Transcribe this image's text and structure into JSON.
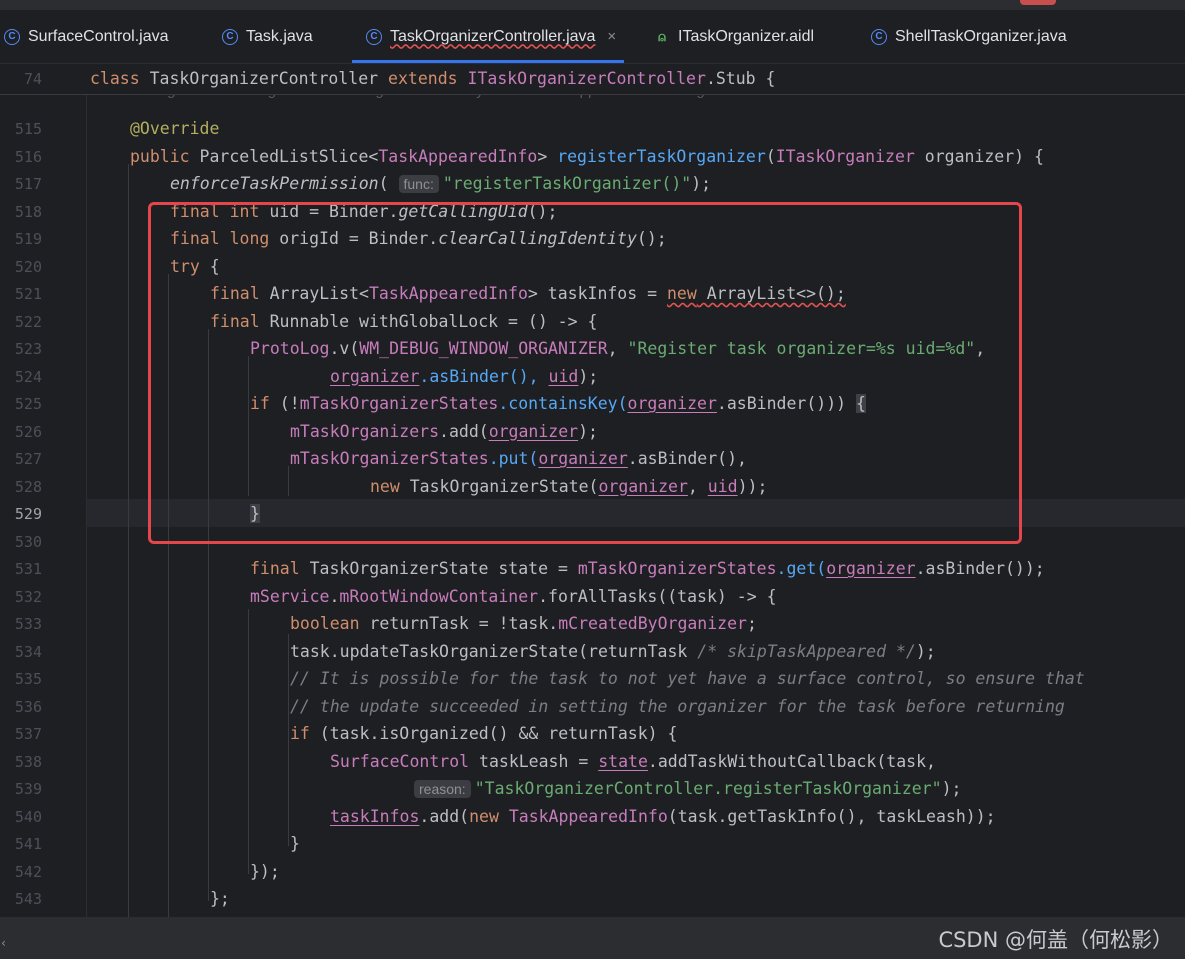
{
  "tabs": [
    {
      "label": "SurfaceControl.java",
      "icon": "java-class-icon"
    },
    {
      "label": "Task.java",
      "icon": "java-class-icon"
    },
    {
      "label": "TaskOrganizerController.java",
      "icon": "java-class-icon",
      "active": true
    },
    {
      "label": "ITaskOrganizer.aidl",
      "icon": "android-aidl-icon"
    },
    {
      "label": "ShellTaskOrganizer.java",
      "icon": "java-class-icon"
    }
  ],
  "tab_close_glyph": "×",
  "sticky": {
    "line_number": "74",
    "code": "class TaskOrganizerController extends ITaskOrganizerController.Stub {"
  },
  "ghost_comment": "Register a TaskOrganizer to manage tasks as they enter the a supported windowing mode.",
  "inlay_hints": {
    "func": "func:",
    "reason": "reason:"
  },
  "current_line": "529",
  "line_numbers": [
    "515",
    "516",
    "517",
    "518",
    "519",
    "520",
    "521",
    "522",
    "523",
    "524",
    "525",
    "526",
    "527",
    "528",
    "529",
    "530",
    "531",
    "532",
    "533",
    "534",
    "535",
    "536",
    "537",
    "538",
    "539",
    "540",
    "541",
    "542",
    "543"
  ],
  "code": {
    "l515": {
      "annot": "@Override"
    },
    "l516": {
      "kw": "public",
      "ret": "ParceledListSlice<",
      "type": "TaskAppearedInfo",
      "close": "> ",
      "method": "registerTaskOrganizer",
      "open": "(",
      "ptype": "ITaskOrganizer",
      "rest": " organizer) {"
    },
    "l517": {
      "call": "enforceTaskPermission",
      "open": "(",
      "str": "\"registerTaskOrganizer()\"",
      "end": ");"
    },
    "l518": {
      "kw": "final int",
      "a": " uid = Binder.",
      "m": "getCallingUid",
      "b": "();"
    },
    "l519": {
      "kw": "final long",
      "a": " origId = Binder.",
      "m": "clearCallingIdentity",
      "b": "();"
    },
    "l520": {
      "kw": "try",
      "a": " {"
    },
    "l521": {
      "kw": "final",
      "a": " ArrayList<",
      "type": "TaskAppearedInfo",
      "b": "> taskInfos = ",
      "kw2": "new",
      "c": " ArrayList<>();"
    },
    "l522": {
      "kw": "final",
      "a": " Runnable withGlobalLock = () -> {"
    },
    "l523": {
      "cls": "ProtoLog",
      "a": ".v(",
      "const": "WM_DEBUG_WINDOW_ORGANIZER",
      "b": ", ",
      "str": "\"Register task organizer=%s uid=%d\"",
      "c": ","
    },
    "l524": {
      "p1": "organizer",
      "a": ".asBinder(), ",
      "p2": "uid",
      "b": ");"
    },
    "l525": {
      "kw": "if",
      "a": " (!",
      "fld": "mTaskOrganizerStates",
      "m": ".containsKey(",
      "p": "organizer",
      "b": ".asBinder())) ",
      "brace": "{"
    },
    "l526": {
      "fld": "mTaskOrganizers",
      "a": ".add(",
      "p": "organizer",
      "b": ");"
    },
    "l527": {
      "fld": "mTaskOrganizerStates",
      "m": ".put(",
      "p": "organizer",
      "b": ".asBinder(),"
    },
    "l528": {
      "kw": "new",
      "a": " TaskOrganizerState(",
      "p1": "organizer",
      "b": ", ",
      "p2": "uid",
      "c": "));"
    },
    "l529": {
      "brace": "}"
    },
    "l531": {
      "kw": "final",
      "a": " TaskOrganizerState state = ",
      "fld": "mTaskOrganizerStates",
      "m": ".get(",
      "p": "organizer",
      "b": ".asBinder());"
    },
    "l532": {
      "fld1": "mService",
      "a": ".",
      "fld2": "mRootWindowContainer",
      "b": ".forAllTasks((task) -> {"
    },
    "l533": {
      "kw": "boolean",
      "a": " returnTask = !task.",
      "fld": "mCreatedByOrganizer",
      "b": ";"
    },
    "l534": {
      "a": "task.updateTaskOrganizerState(returnTask ",
      "cm": "/* skipTaskAppeared */",
      "b": ");"
    },
    "l535": {
      "cm": "// It is possible for the task to not yet have a surface control, so ensure that"
    },
    "l536": {
      "cm": "// the update succeeded in setting the organizer for the task before returning"
    },
    "l537": {
      "kw": "if",
      "a": " (task.isOrganized() && returnTask) {"
    },
    "l538": {
      "cls": "SurfaceControl",
      "a": " taskLeash = ",
      "p": "state",
      "b": ".addTaskWithoutCallback(task,"
    },
    "l539": {
      "str": "\"TaskOrganizerController.registerTaskOrganizer\"",
      "a": ");"
    },
    "l540": {
      "p": "taskInfos",
      "a": ".add(",
      "kw": "new",
      "cls": " TaskAppearedInfo",
      "b": "(task.getTaskInfo(), taskLeash));"
    },
    "l541": {
      "a": "}"
    },
    "l542": {
      "a": "});"
    },
    "l543": {
      "a": "};"
    }
  },
  "watermark": "CSDN @何盖（何松影）",
  "colors": {
    "accent": "#3574f0",
    "highlight_box": "#e4464c",
    "keyword": "#cf8e6d",
    "string": "#6aab73",
    "method": "#56a8f5",
    "field": "#c77dbb"
  }
}
